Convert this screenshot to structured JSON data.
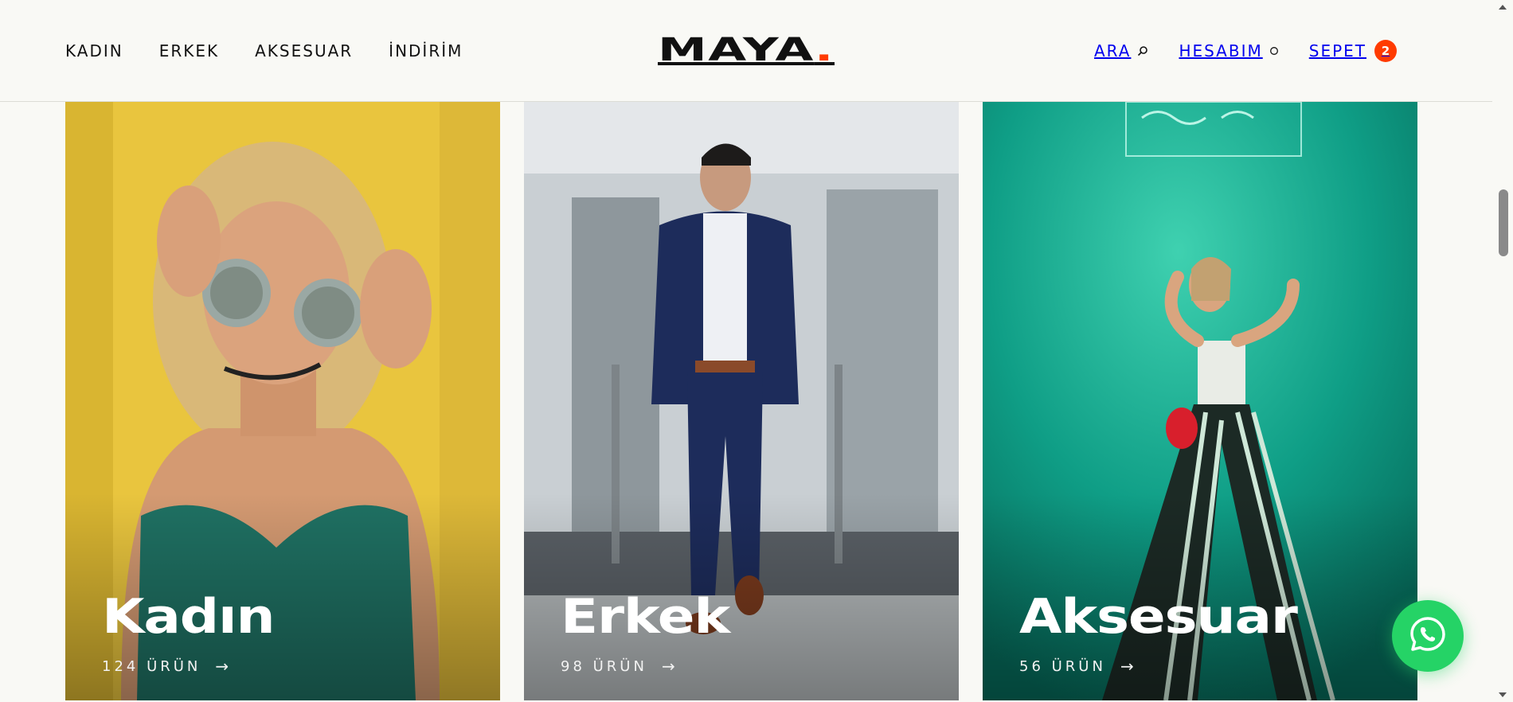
{
  "header": {
    "nav_left": [
      "KADIN",
      "ERKEK",
      "AKSESUAR",
      "İNDİRİM"
    ],
    "logo": {
      "text": "MAYA",
      "dot": "."
    },
    "search_label": "ARA",
    "account_label": "HESABIM",
    "cart_label": "SEPET",
    "cart_count": "2"
  },
  "categories": [
    {
      "title": "Kadın",
      "count": "124 ÜRÜN",
      "arrow": "→",
      "bg_color": "#e8c43c"
    },
    {
      "title": "Erkek",
      "count": "98 ÜRÜN",
      "arrow": "→",
      "bg_color": "#b9bfc3"
    },
    {
      "title": "Aksesuar",
      "count": "56 ÜRÜN",
      "arrow": "→",
      "bg_color": "#11a58b"
    }
  ],
  "colors": {
    "accent": "#ff3b00",
    "whatsapp": "#25d366",
    "background": "#f9f9f5"
  },
  "icons": {
    "search": "search-icon",
    "account": "account-icon",
    "whatsapp": "whatsapp-icon"
  }
}
